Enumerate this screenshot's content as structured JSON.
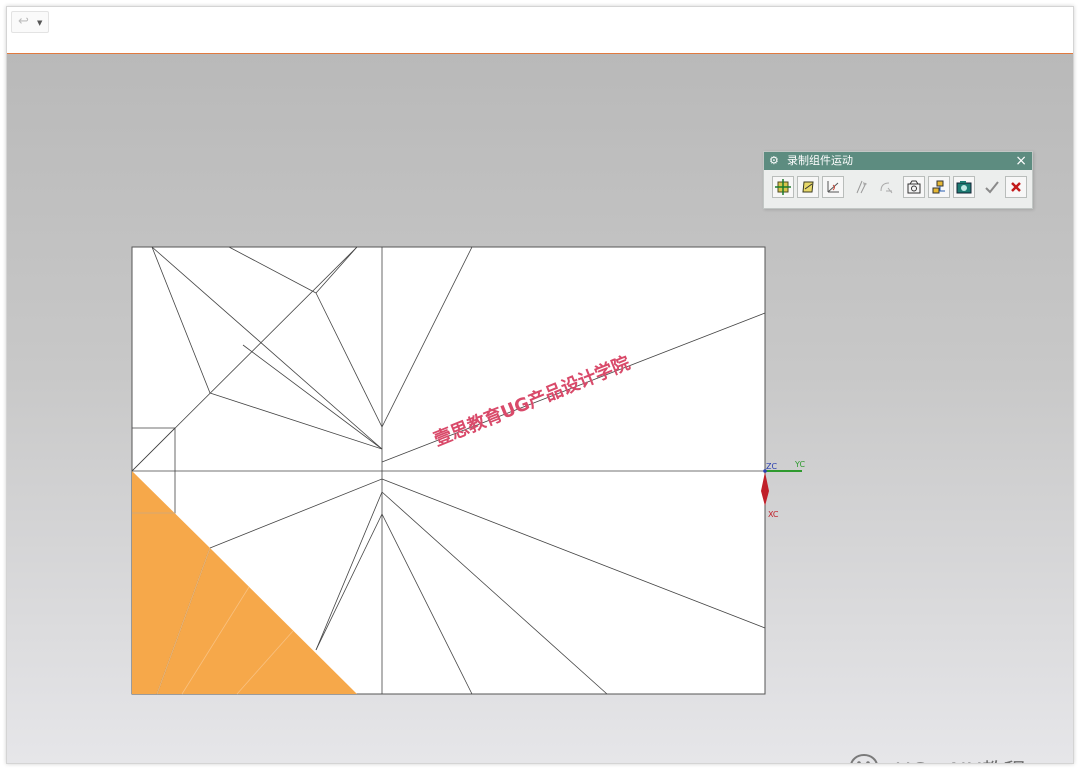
{
  "toolbar": {
    "undo_icon": "undo-arrow-icon",
    "dropdown_icon": "dropdown-caret-icon"
  },
  "dialog": {
    "title": "录制组件运动",
    "header_color": "#5d8c80",
    "buttons": [
      {
        "name": "move-component",
        "icon": "move-component-icon"
      },
      {
        "name": "move-object",
        "icon": "move-object-icon"
      },
      {
        "name": "only-move-handle",
        "icon": "only-move-handle-icon"
      },
      {
        "name": "dynamic-snap",
        "icon": "snap-icon"
      },
      {
        "name": "step-move",
        "icon": "step-icon"
      },
      {
        "name": "record-camera",
        "icon": "camera-record-icon"
      },
      {
        "name": "component-list",
        "icon": "component-list-icon"
      },
      {
        "name": "capture-image",
        "icon": "capture-image-icon"
      },
      {
        "name": "ok",
        "icon": "check-icon"
      },
      {
        "name": "cancel",
        "icon": "cancel-x-icon"
      }
    ]
  },
  "canvas": {
    "fill_color": "#f6a84a",
    "watermark_text": "壹思教育UG产品设计学院",
    "axes": {
      "z_label": "ZC",
      "y_label": "YC",
      "x_label": "XC"
    }
  },
  "brand": {
    "text": "UG一NX教程",
    "icon": "wechat-icon"
  }
}
